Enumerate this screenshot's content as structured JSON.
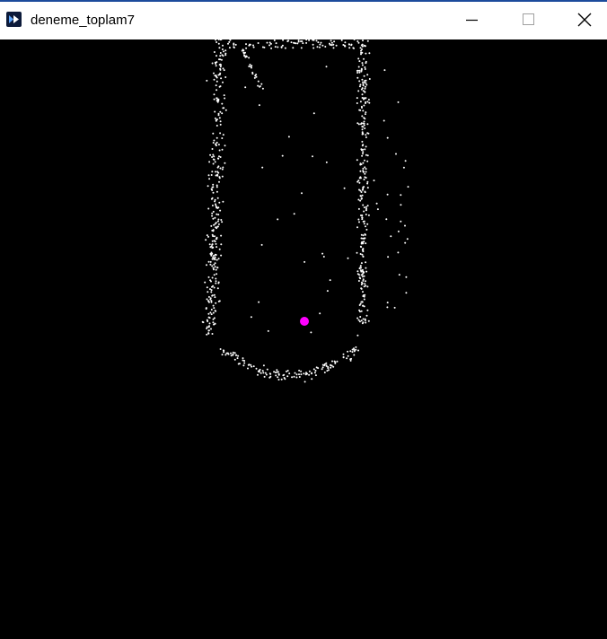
{
  "window": {
    "title": "deneme_toplam7"
  },
  "icons": {
    "app": "app-icon",
    "minimize": "minimize-icon",
    "maximize": "maximize-icon",
    "close": "close-icon"
  },
  "colors": {
    "background": "#000000",
    "points": "#ffffff",
    "marker": "#ff00ff",
    "titlebar": "#ffffff",
    "accent": "#1c4b9c"
  }
}
